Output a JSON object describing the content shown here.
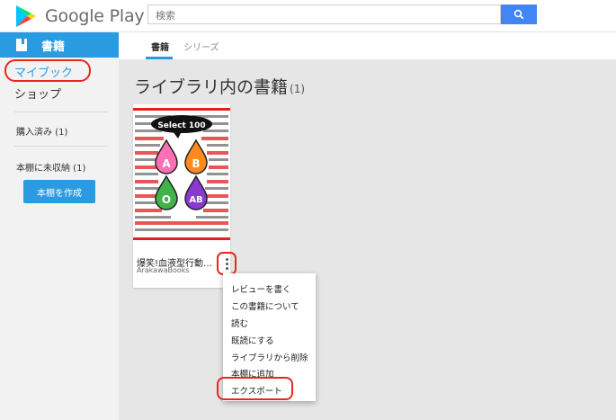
{
  "app": {
    "name": "Google Play"
  },
  "search": {
    "placeholder": "検索"
  },
  "sidebar": {
    "section": "書籍",
    "mybook": "マイブック",
    "shop": "ショップ",
    "purchased": "購入済み (1)",
    "unshelved": "本棚に未収納 (1)",
    "create_shelf": "本棚を作成"
  },
  "tabs": {
    "books": "書籍",
    "series": "シリーズ"
  },
  "main": {
    "title": "ライブラリ内の書籍",
    "count": "(1)"
  },
  "book": {
    "title": "爆笑!血液型行動…",
    "author": "ArakawaBooks",
    "cover": {
      "badge": "Select 100",
      "drops": [
        "A",
        "B",
        "O",
        "AB"
      ]
    }
  },
  "context_menu": {
    "items": [
      "レビューを書く",
      "この書籍について",
      "読む",
      "既読にする",
      "ライブラリから削除",
      "本棚に追加",
      "エクスポート"
    ]
  },
  "colors": {
    "accent": "#2a9be0",
    "search_button": "#4285f4",
    "highlight": "#e8271c"
  }
}
